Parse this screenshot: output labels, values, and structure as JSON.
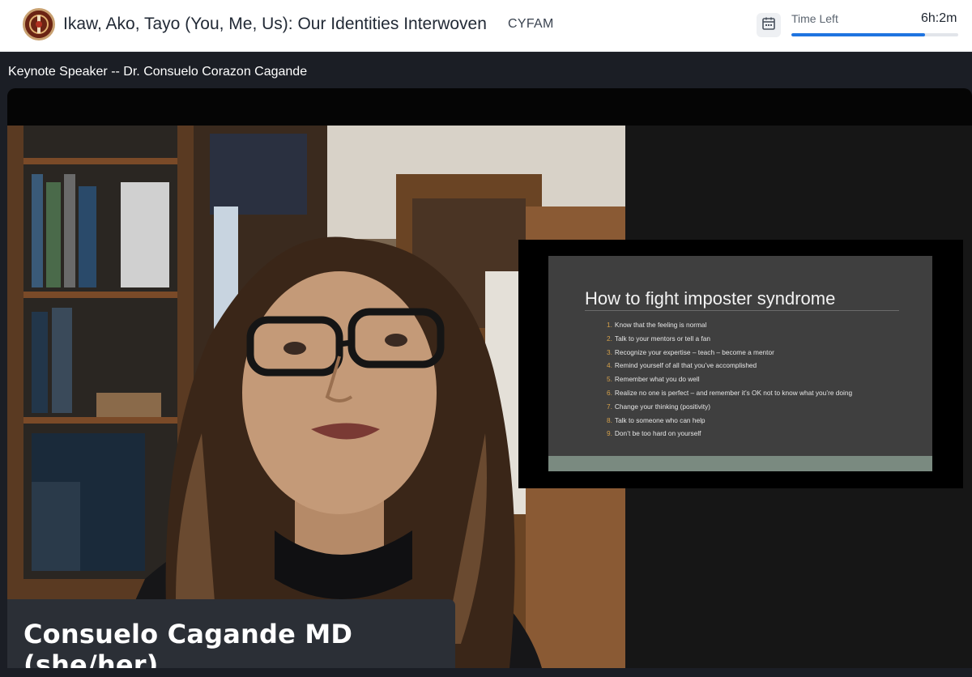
{
  "header": {
    "event_title": "Ikaw, Ako, Tayo (You, Me, Us): Our Identities Interwoven",
    "org": "CYFAM",
    "calendar_icon": "calendar-icon",
    "time_left_label": "Time Left",
    "time_left_value": "6h:2m",
    "time_progress": 0.8,
    "accent_color": "#1f74e0"
  },
  "session": {
    "title": "Keynote Speaker -- Dr. Consuelo Corazon Cagande"
  },
  "video": {
    "speaker_name": "Consuelo Cagande MD (she/her)"
  },
  "slide": {
    "title": "How to fight imposter syndrome",
    "items": [
      {
        "num": "1.",
        "text": "Know that the feeling is normal"
      },
      {
        "num": "2.",
        "text": "Talk to your mentors or tell a fan"
      },
      {
        "num": "3.",
        "text": "Recognize your expertise – teach – become a mentor"
      },
      {
        "num": "4.",
        "text": "Remind yourself of all that you’ve accomplished"
      },
      {
        "num": "5.",
        "text": "Remember what you do well"
      },
      {
        "num": "6.",
        "text": "Realize no one is perfect – and remember it’s OK not to know what you’re doing"
      },
      {
        "num": "7.",
        "text": "Change your thinking (positivity)"
      },
      {
        "num": "8.",
        "text": "Talk to someone who can help"
      },
      {
        "num": "9.",
        "text": "Don’t be too hard on yourself"
      }
    ]
  }
}
